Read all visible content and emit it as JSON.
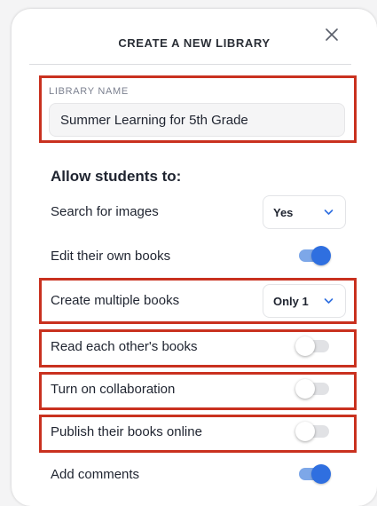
{
  "modal": {
    "title": "CREATE A NEW LIBRARY"
  },
  "library_name": {
    "label": "LIBRARY NAME",
    "value": "Summer Learning for 5th Grade"
  },
  "permissions": {
    "heading": "Allow students to:",
    "search_images": {
      "label": "Search for images",
      "value": "Yes"
    },
    "edit_books": {
      "label": "Edit their own books",
      "enabled": true
    },
    "multiple_books": {
      "label": "Create multiple books",
      "value": "Only 1"
    },
    "read_others": {
      "label": "Read each other's books",
      "enabled": false
    },
    "collaboration": {
      "label": "Turn on collaboration",
      "enabled": false
    },
    "publish_online": {
      "label": "Publish their books online",
      "enabled": false
    },
    "add_comments": {
      "label": "Add comments",
      "enabled": true
    }
  },
  "colors": {
    "accent": "#2f6fe0",
    "highlight": "#c9311f"
  },
  "icons": {
    "close": "close-icon",
    "dropdown": "chevron-down-icon"
  }
}
